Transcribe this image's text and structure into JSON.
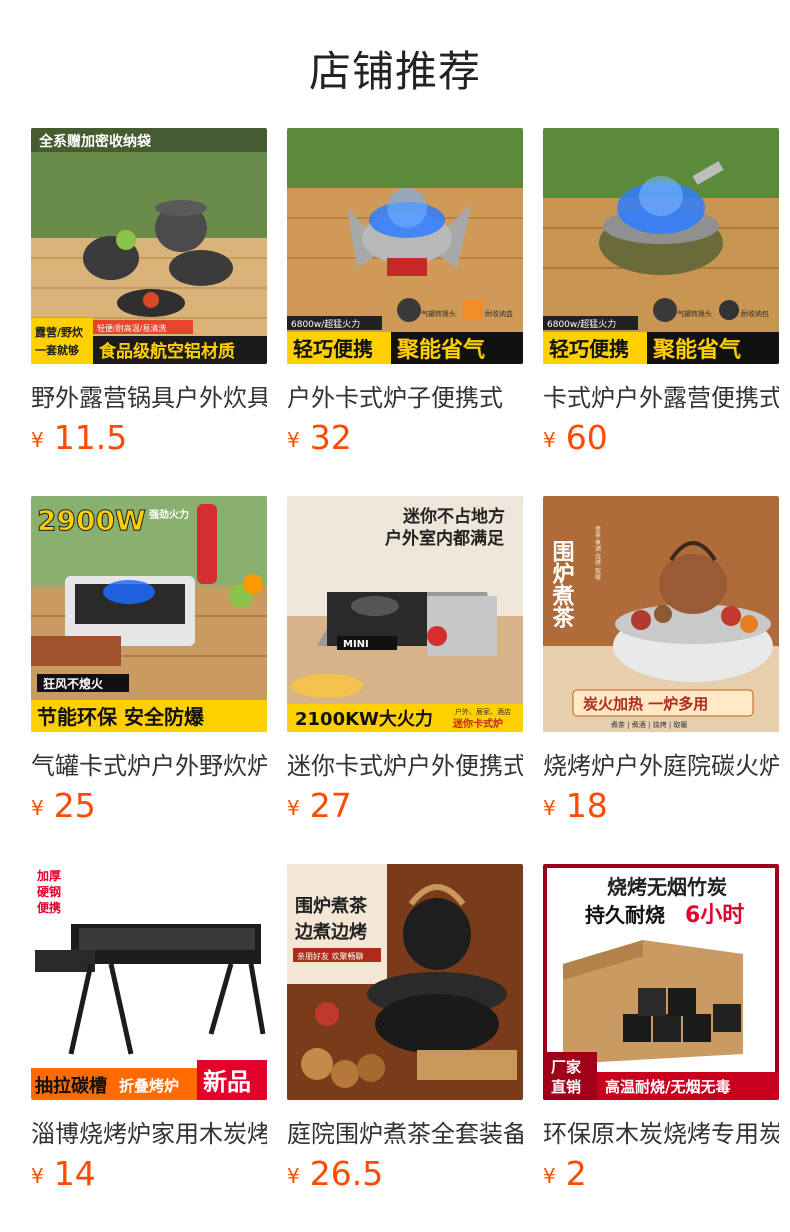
{
  "page": {
    "title": "店铺推荐"
  },
  "products": [
    {
      "name": "野外露营锅具户外炊具",
      "currency": "¥",
      "price": "11.5",
      "image": {
        "top_text": "全系赠加密收纳袋",
        "side_text_1": "露营/野炊",
        "side_text_2": "一套就够",
        "feature_text": "轻便/耐高温/易清洗",
        "bottom_text": "食品级航空铝材质",
        "colors": {
          "bg": "#6a8c4a",
          "table": "#d9b37a",
          "pot": "#3b3b3b",
          "banner": "#1b1b1b",
          "accent": "#f2c300"
        }
      }
    },
    {
      "name": "户外卡式炉子便携式",
      "currency": "¥",
      "price": "32",
      "image": {
        "tag_text": "6800w/超猛火力",
        "left_text": "轻巧便携",
        "right_text": "聚能省气",
        "small_1": "气罐转换头",
        "small_2": "耐收纳盒",
        "colors": {
          "bg": "#cf9a58",
          "stove": "#b8b8b8",
          "flame": "#2f7dff",
          "banner": "#ffd000"
        }
      }
    },
    {
      "name": "卡式炉户外露营便携式",
      "currency": "¥",
      "price": "60",
      "image": {
        "tag_text": "6800w/超猛火力",
        "left_text": "轻巧便携",
        "right_text": "聚能省气",
        "small_1": "气罐转换头",
        "small_2": "耐收纳包",
        "colors": {
          "bg": "#c99552",
          "stove": "#6b6a3a",
          "flame": "#2f7dff",
          "banner": "#ffd000"
        }
      }
    },
    {
      "name": "气罐卡式炉户外野炊炉",
      "currency": "¥",
      "price": "25",
      "image": {
        "power_text": "2900W",
        "power_sub": "强劲火力",
        "mid_text": "狂风不熄火",
        "bottom_text": "节能环保 安全防爆",
        "colors": {
          "bg": "#8ab070",
          "stove": "#e6e6e6",
          "flame": "#1f6bff",
          "banner": "#ffd000"
        }
      }
    },
    {
      "name": "迷你卡式炉户外便携式",
      "currency": "¥",
      "price": "27",
      "image": {
        "top_text_1": "迷你不占地方",
        "top_text_2": "户外室内都满足",
        "brand_text": "MINI",
        "bottom_text": "2100KW大火力",
        "side_text_1": "户外、居家、酒店",
        "side_text_2": "迷你卡式炉",
        "colors": {
          "bg": "#efe6da",
          "stove": "#9a9a9a",
          "banner": "#ffd000"
        }
      }
    },
    {
      "name": "烧烤炉户外庭院碳火炉",
      "currency": "¥",
      "price": "18",
      "image": {
        "vertical_text": "围炉煮茶",
        "side_small": "煮茶·煮酒·烧烤·取暖",
        "bottom_text": "炭火加热 一炉多用",
        "sub_text": "煮茶 | 煮酒 | 烧烤 | 取暖",
        "colors": {
          "bg": "#b06b3a",
          "stove": "#e9e9e9",
          "banner": "#ffe9c6"
        }
      }
    },
    {
      "name": "淄博烧烤炉家用木炭烤炉",
      "currency": "¥",
      "price": "14",
      "image": {
        "feature_1": "加厚",
        "feature_2": "硬钢",
        "feature_3": "便携",
        "left_text": "抽拉碳槽",
        "mid_text": "折叠烤炉",
        "new_text": "新品",
        "colors": {
          "bg": "#ffffff",
          "grill": "#1c1c1c",
          "banner": "#ff6b00",
          "accent": "#e5002b"
        }
      }
    },
    {
      "name": "庭院围炉煮茶全套装备",
      "currency": "¥",
      "price": "26.5",
      "image": {
        "title_1": "围炉煮茶",
        "title_2": "边煮边烤",
        "sub_text": "亲朋好友 欢聚畅聊",
        "colors": {
          "bg": "#7a3b1b",
          "panel": "#f3e6d4",
          "kettle": "#1e1e1e",
          "wood": "#c8985a"
        }
      }
    },
    {
      "name": "环保原木炭烧烤专用炭",
      "currency": "¥",
      "price": "2",
      "image": {
        "title_1": "烧烤无烟竹炭",
        "title_2": "持久耐烧",
        "title_highlight": "6小时",
        "left_tag_1": "厂家",
        "left_tag_2": "直销",
        "bottom_text": "高温耐烧/无烟无毒",
        "colors": {
          "bg": "#ffffff",
          "frame": "#a0001a",
          "box": "#c99b62",
          "charcoal": "#1a1a1a"
        }
      }
    }
  ]
}
